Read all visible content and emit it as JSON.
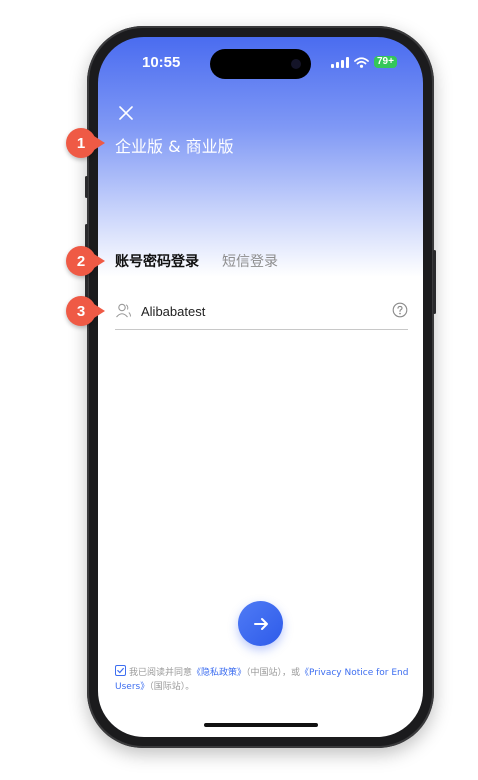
{
  "status_bar": {
    "time": "10:55",
    "battery": "79+"
  },
  "login": {
    "close_icon": "close-icon",
    "title": "企业版 & 商业版",
    "tabs": [
      {
        "label": "账号密码登录",
        "active": true
      },
      {
        "label": "短信登录",
        "active": false
      }
    ],
    "username": {
      "value": "Alibabatest",
      "icon": "user-icon",
      "help_icon": "help-icon"
    },
    "next_button_icon": "arrow-right-icon",
    "agreement": {
      "checked": true,
      "prefix": "我已阅读并同意",
      "privacy_policy": "《隐私政策》",
      "middle": "（中国站），或",
      "privacy_notice": "《Privacy Notice for End Users》",
      "suffix": "（国际站）。"
    }
  },
  "callouts": [
    "1",
    "2",
    "3"
  ],
  "colors": {
    "accent": "#3d6ef0",
    "badge": "#ef5a45",
    "header_top": "#4a6cf0"
  }
}
